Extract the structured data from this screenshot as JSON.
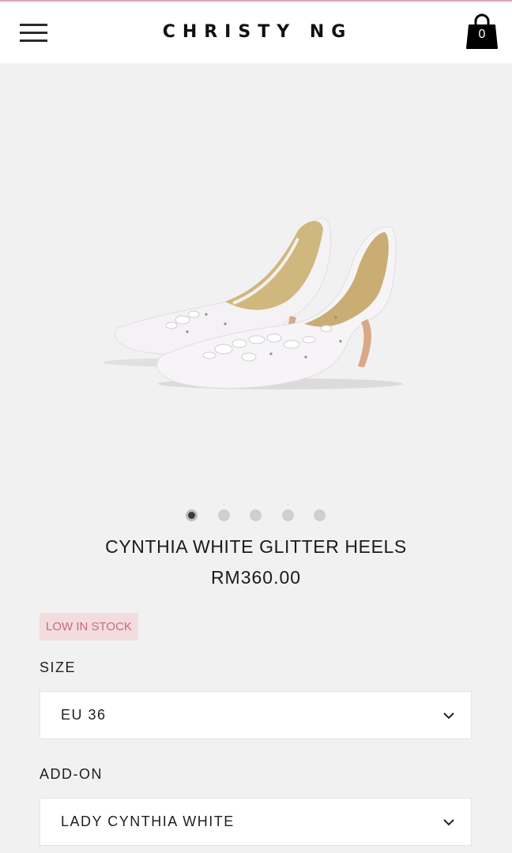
{
  "header": {
    "brand": "CHRISTY NG",
    "cart_count": "0",
    "menu_icon": "hamburger-menu-icon",
    "cart_icon": "shopping-bag-icon"
  },
  "gallery": {
    "image_alt": "white pointed-toe heels with floral lace appliqué",
    "slide_count": 5,
    "active_slide": 1
  },
  "product": {
    "title": "CYNTHIA WHITE GLITTER HEELS",
    "price": "RM360.00",
    "stock_badge": "LOW IN STOCK"
  },
  "options": {
    "size_label": "SIZE",
    "size_value": "EU 36",
    "addon_label": "ADD-ON",
    "addon_value": "LADY CYNTHIA WHITE"
  },
  "colors": {
    "accent_line": "#d9a6ad",
    "badge_bg": "#f3dcde",
    "badge_text": "#c56b78",
    "page_bg": "#f2f1f1"
  }
}
